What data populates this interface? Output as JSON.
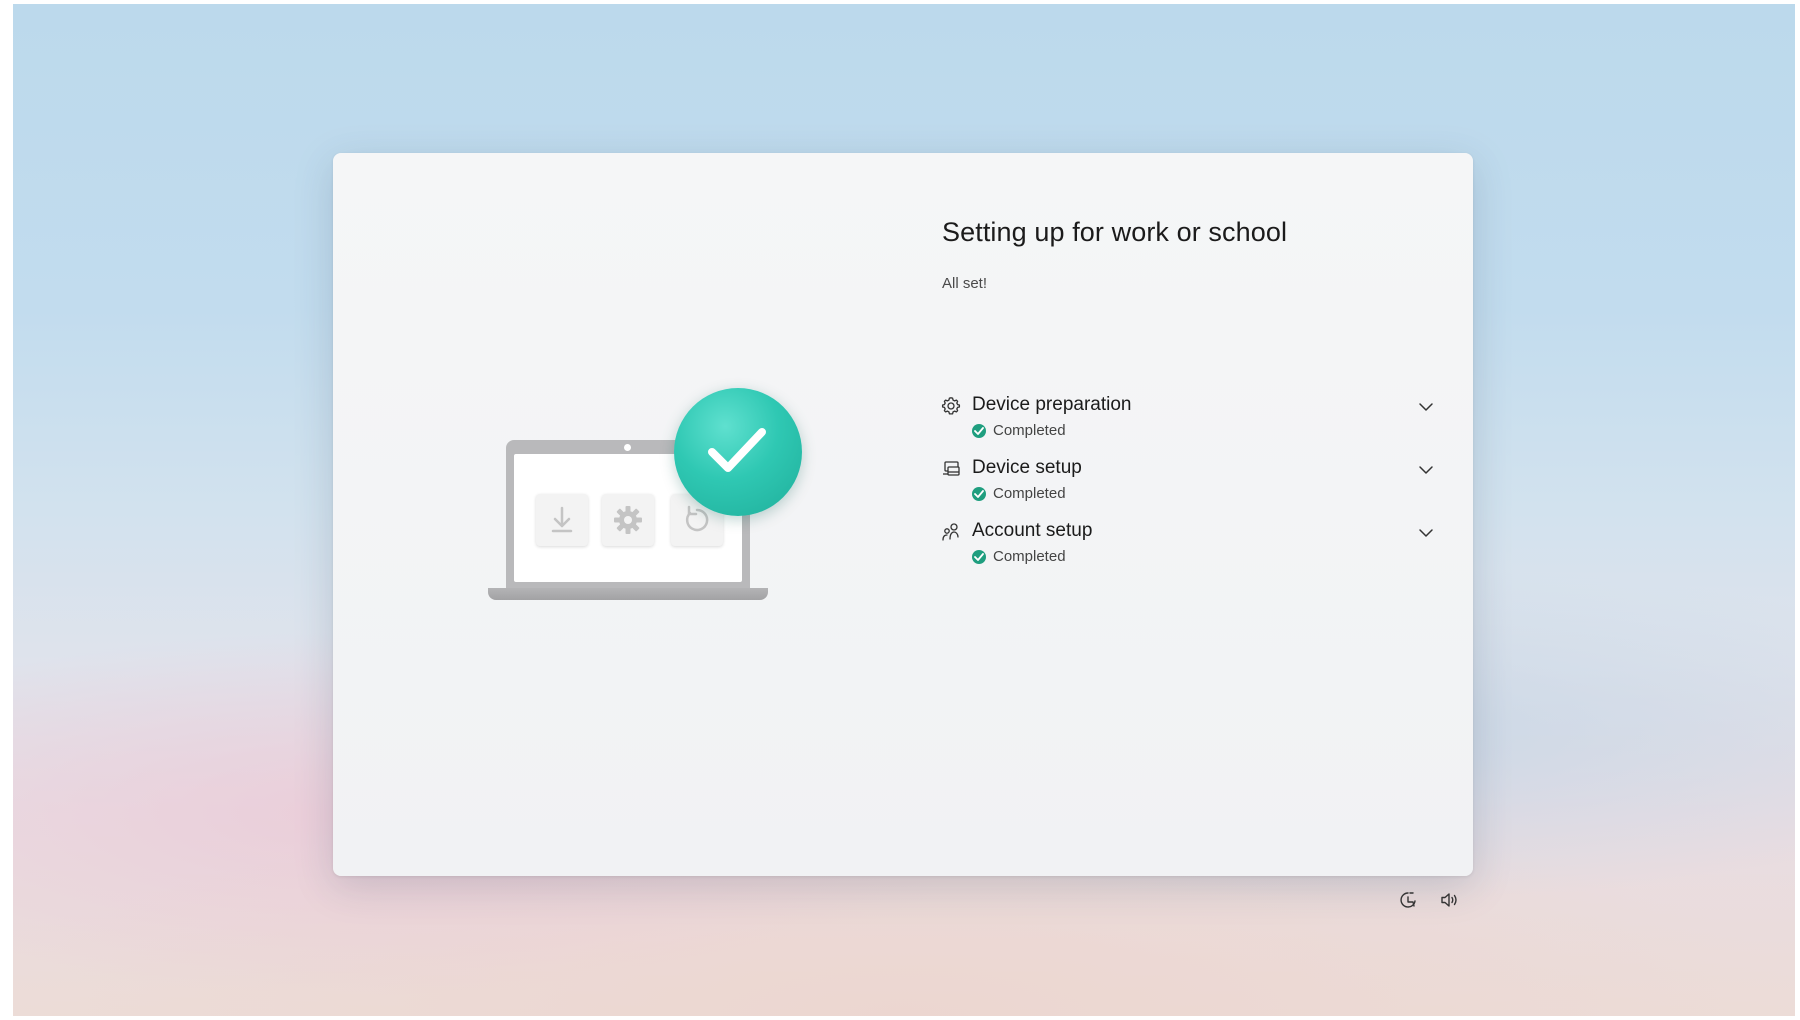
{
  "setup": {
    "title": "Setting up for work or school",
    "subtitle": "All set!",
    "steps": [
      {
        "label": "Device preparation",
        "status": "Completed",
        "icon": "gear-icon"
      },
      {
        "label": "Device setup",
        "status": "Completed",
        "icon": "device-setup-icon"
      },
      {
        "label": "Account setup",
        "status": "Completed",
        "icon": "account-icon"
      }
    ]
  },
  "footer": {
    "icons": [
      "accessibility-icon",
      "volume-icon"
    ]
  },
  "colors": {
    "accent_teal": "#2fc8b3",
    "status_green": "#1f9e7f",
    "card_bg": "#f3f4f5"
  }
}
